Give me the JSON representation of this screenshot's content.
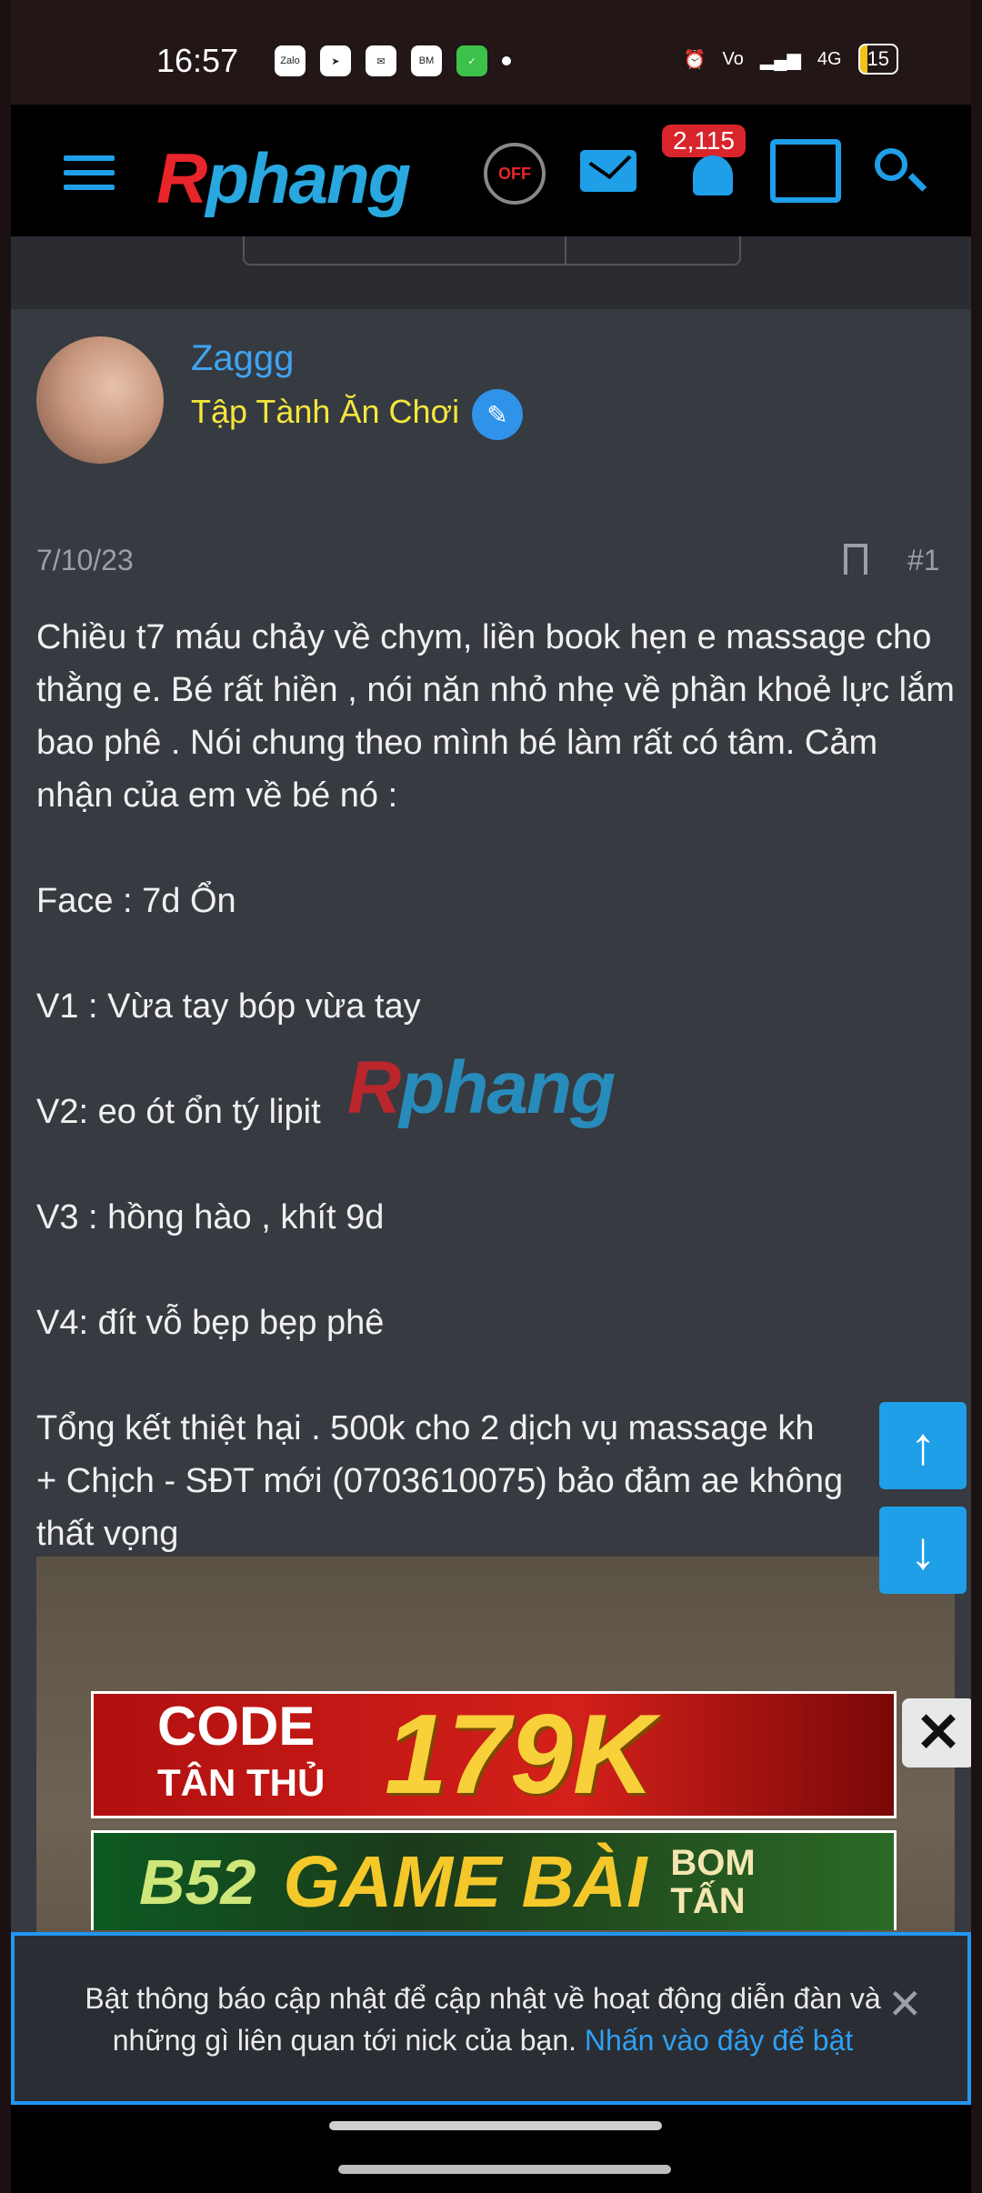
{
  "status_bar": {
    "time": "16:57",
    "signal_label": "4G",
    "battery": "15"
  },
  "header": {
    "logo": "Rphang",
    "notification_count": "2,115"
  },
  "user": {
    "name": "Zaggg",
    "title": "Tập Tành Ăn Chơi"
  },
  "post": {
    "date": "7/10/23",
    "number": "#1",
    "body": "Chiều t7 máu chảy về chym, liền book hẹn e massage cho thằng e. Bé rất hiền , nói năn nhỏ nhẹ về phần khoẻ lực lắm bao phê . Nói chung theo mình bé làm rất có tâm. Cảm nhận của em về bé nó :\n\nFace : 7d Ổn\n\nV1 : Vừa tay bóp vừa tay\n\nV2: eo ót ổn tý lipit\n\nV3 : hồng hào , khít 9d\n\nV4: đít vỗ bẹp bẹp phê\n\nTổng kết thiệt hại . 500k cho 2 dịch vụ massage kh\n+ Chịch - SĐT mới (0703610075) bảo đảm ae không\nthất vọng",
    "watermark": "Rphang"
  },
  "ads": {
    "ad1_line1": "CODE",
    "ad1_line2": "TÂN THỦ",
    "ad1_amount": "179K",
    "ad2_brand": "B52",
    "ad2_text": "GAME BÀI",
    "ad2_tag1": "BOM",
    "ad2_tag2": "TẤN"
  },
  "notification": {
    "message": "Bật thông báo cập nhật để cập nhật về hoạt động diễn đàn và những gì liên quan tới nick của bạn.",
    "link": "Nhấn vào đây để bật"
  },
  "colors": {
    "accent": "#1e9fe8",
    "user_title": "#f4e63b",
    "badge": "#d8252b"
  }
}
